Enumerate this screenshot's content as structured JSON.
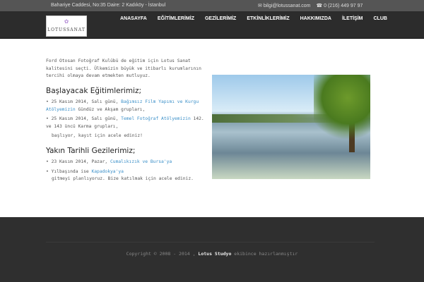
{
  "topbar": {
    "address": "Bahariye Caddesi, No:35  Daire: 2 Kadıköy - İstanbul",
    "email": "bilgi@lotussanat.com",
    "phone": "0 (216) 449 97 97"
  },
  "logo": {
    "text": "LOTUSSANAT"
  },
  "menu": [
    "ANASAYFA",
    "EĞİTİMLERİMİZ",
    "GEZİLERİMİZ",
    "ETKİNLİKLERİMİZ",
    "HAKKIMIZDA",
    "İLETİŞİM",
    "CLUB"
  ],
  "intro": "Ford Otosan Fotoğraf Kulübü de eğitim için Lotus Sanat kalitesini seçti. Ülkemizin büyük ve itibarlı kurumlarının tercihi olmaya devam etmekten mutluyuz.",
  "trainings": {
    "title": "Başlayacak Eğitimlerimiz;",
    "items": [
      {
        "pre": "25 Kasım 2014, Salı günü, ",
        "link": "Bağımsız Film Yapımı ve Kurgu Atölyemizin",
        "post": " Gündüz ve Akşam grupları,"
      },
      {
        "pre": "25 Kasım 2014, Salı günü, ",
        "link": "Temel Fotoğraf Atölyemizin",
        "post": " 142. ve 143 üncü Karma grupları,"
      }
    ],
    "note": "başlıyor, kayıt için acele ediniz!"
  },
  "trips": {
    "title": "Yakın Tarihli Gezilerimiz;",
    "items": [
      {
        "pre": "23 Kasım 2014, Pazar, ",
        "link": "Cumalıkızık ve Bursa'ya",
        "post": ""
      },
      {
        "pre": "Yılbaşında ise ",
        "link": "Kapadokya'ya",
        "post": ""
      }
    ],
    "note": "gitmeyi planlıyoruz. Bize katılmak için acele ediniz."
  },
  "footer": {
    "pre": "Copyright © 2008 - 2014 , ",
    "brand": "Lotus Studyo",
    "post": " ekibince hazırlanmıştır"
  }
}
